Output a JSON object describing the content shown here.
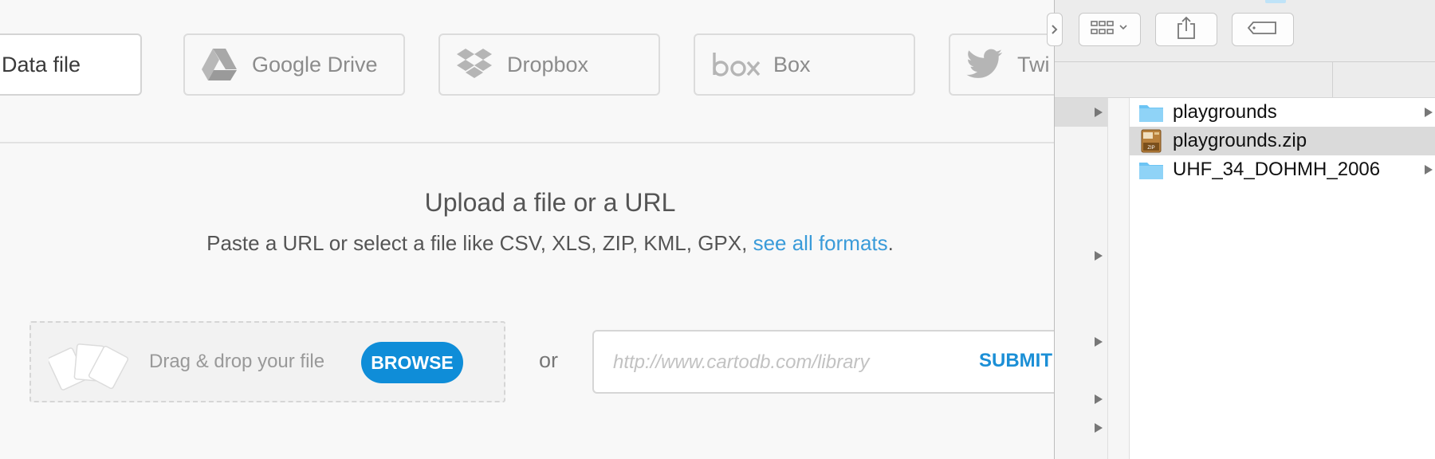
{
  "sources": [
    {
      "label": "Data file",
      "icon": "file-icon",
      "active": true
    },
    {
      "label": "Google Drive",
      "icon": "google-drive-icon",
      "active": false
    },
    {
      "label": "Dropbox",
      "icon": "dropbox-icon",
      "active": false
    },
    {
      "label": "Box",
      "icon": "box-icon",
      "active": false
    },
    {
      "label": "Twi",
      "icon": "twitter-icon",
      "active": false
    }
  ],
  "upload": {
    "title": "Upload a file or a URL",
    "subtitle_prefix": "Paste a URL or select a file like CSV, XLS, ZIP, KML, GPX,",
    "formats_link": "see all formats",
    "subtitle_suffix": "."
  },
  "dropzone": {
    "label": "Drag & drop your file",
    "browse_label": "BROWSE"
  },
  "or_label": "or",
  "url_field": {
    "value": "",
    "placeholder": "http://www.cartodb.com/library",
    "submit_label": "SUBMIT"
  },
  "finder": {
    "files": [
      {
        "name": "playgrounds",
        "icon": "folder-icon",
        "has_children": true,
        "selected": false
      },
      {
        "name": "playgrounds.zip",
        "icon": "zip-archive-icon",
        "has_children": false,
        "selected": true
      },
      {
        "name": "UHF_34_DOHMH_2006",
        "icon": "folder-icon",
        "has_children": true,
        "selected": false
      }
    ]
  },
  "colors": {
    "accent": "#0f8dd8",
    "link": "#3a9bd9",
    "folder": "#6cc4f4"
  }
}
